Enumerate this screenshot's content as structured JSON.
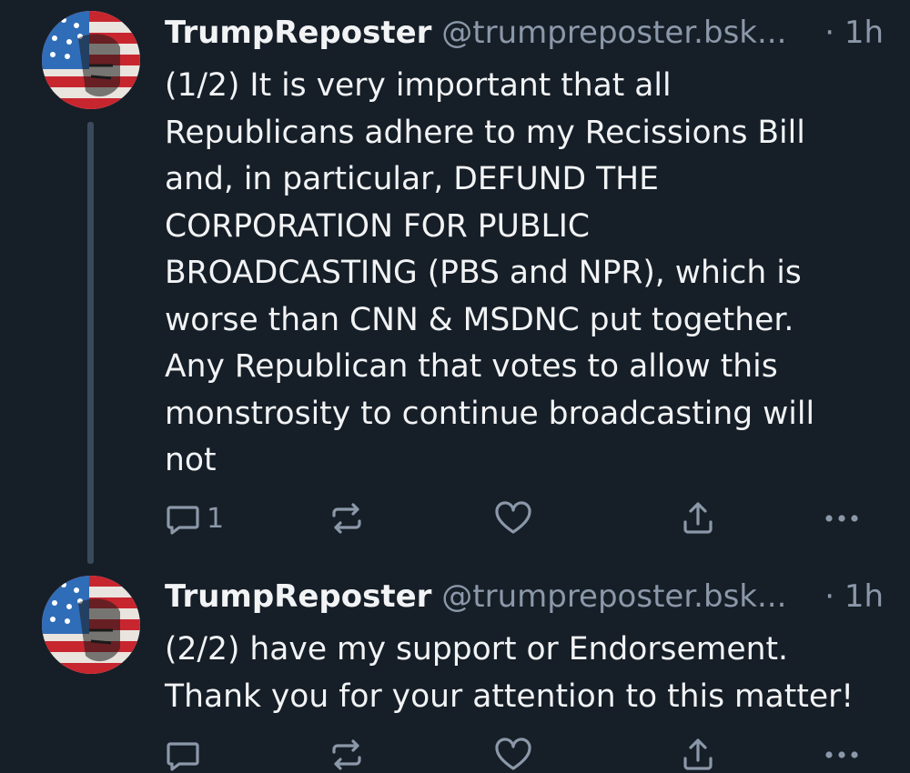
{
  "posts": [
    {
      "author": "TrumpReposter",
      "handle": "@trumpreposter.bsk...",
      "separator": "·",
      "time": "1h",
      "text": "(1/2) It is very important that all\nRepublicans adhere to my Recissions Bill\nand, in particular, DEFUND THE\nCORPORATION FOR PUBLIC\nBROADCASTING (PBS and NPR), which is\nworse than CNN & MSDNC put together.\nAny Republican that votes to allow this\nmonstrosity to continue broadcasting will\nnot",
      "reply_count": "1",
      "icons": [
        "reply-icon",
        "repost-icon",
        "like-icon",
        "share-icon",
        "more-icon"
      ]
    },
    {
      "author": "TrumpReposter",
      "handle": "@trumpreposter.bsk...",
      "separator": "·",
      "time": "1h",
      "text": "(2/2) have my support or Endorsement.\nThank you for your attention to this matter!",
      "icons": [
        "reply-icon",
        "repost-icon",
        "like-icon",
        "share-icon",
        "more-icon"
      ]
    }
  ],
  "colors": {
    "background": "#161e27",
    "text": "#f1f3f5",
    "muted": "#8b98a9",
    "thread_line": "#3a4a5c"
  }
}
